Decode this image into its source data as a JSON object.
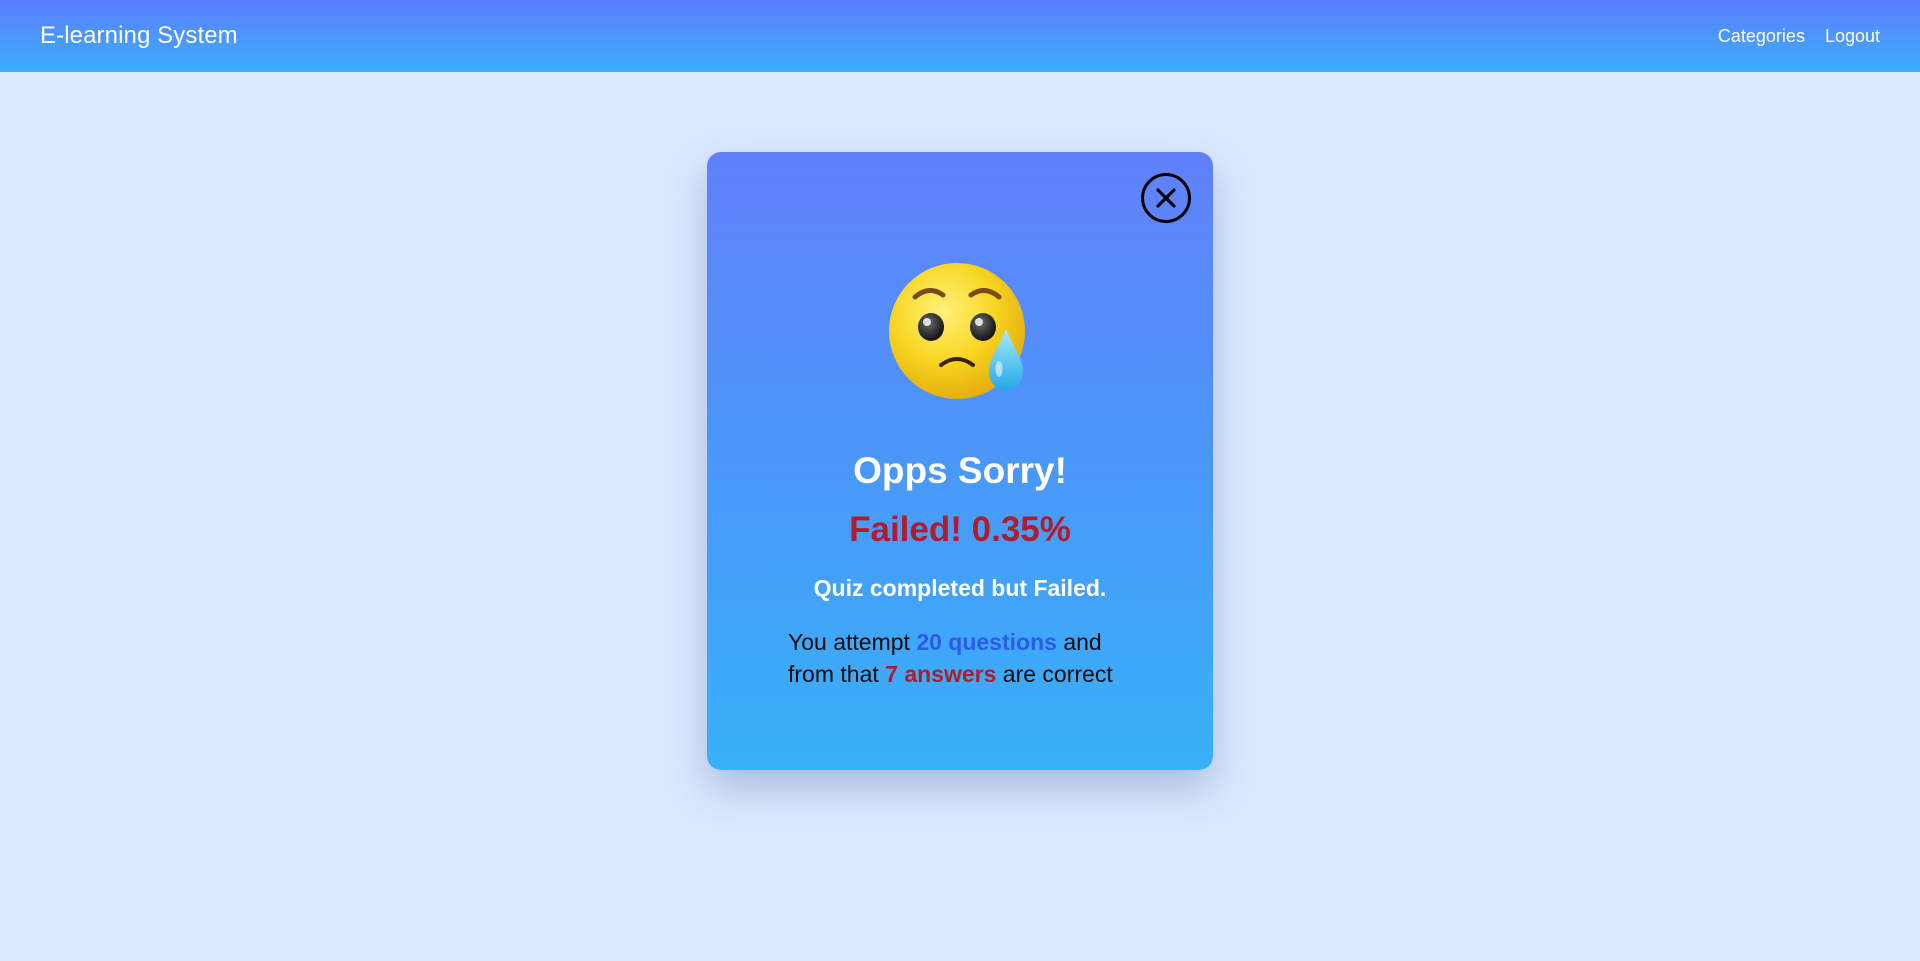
{
  "navbar": {
    "brand": "E-learning System",
    "links": [
      "Categories",
      "Logout"
    ]
  },
  "modal": {
    "close_icon": "close-circle-icon",
    "emoji_icon": "crying-face-icon",
    "title": "Opps Sorry!",
    "result_label": "Failed!",
    "result_score": "0.35%",
    "subtitle": "Quiz completed but Failed.",
    "details": {
      "prefix": "You attempt",
      "questions": "20 questions",
      "middle": "and from that",
      "answers": "7 answers",
      "suffix": "are correct"
    }
  },
  "colors": {
    "page_background": "#dbe9ff",
    "navbar_gradient_top": "#5c7dfc",
    "navbar_gradient_bottom": "#3caefb",
    "modal_gradient_top": "#6180fd",
    "modal_gradient_bottom": "#38b1f9",
    "fail_red": "#b11c2a",
    "highlight_blue": "#2b5ce6"
  }
}
